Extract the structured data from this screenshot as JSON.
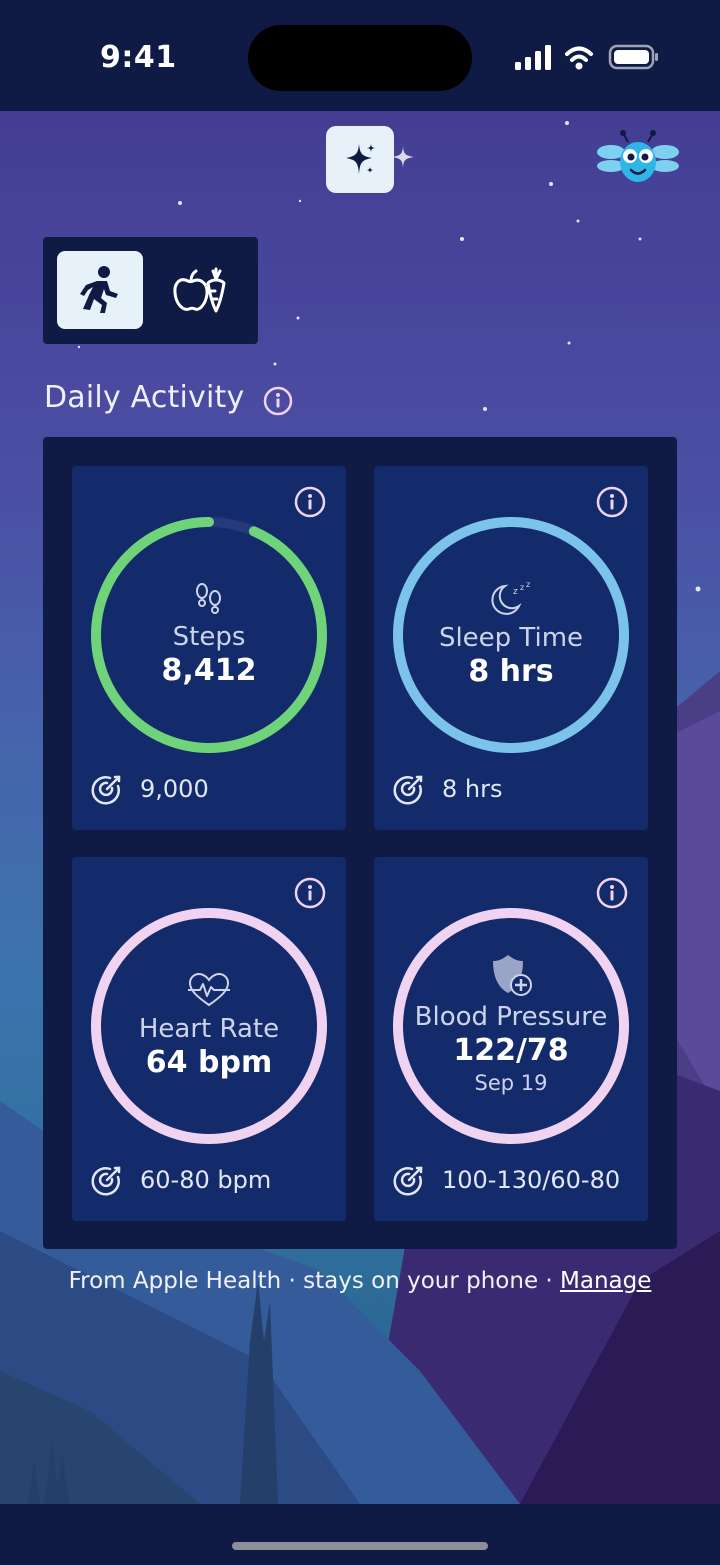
{
  "status_bar": {
    "time": "9:41"
  },
  "header": {
    "sparkle_icon": "sparkle-icon",
    "mascot": "dragonfly-mascot"
  },
  "tabs": [
    {
      "name": "activity",
      "icon": "running-person-icon",
      "selected": true
    },
    {
      "name": "nutrition",
      "icon": "apple-carrot-icon",
      "selected": false
    }
  ],
  "section": {
    "title": "Daily Activity"
  },
  "cards": {
    "steps": {
      "label": "Steps",
      "value": "8,412",
      "goal": "9,000",
      "progress": 0.935,
      "color": "#6fd37a"
    },
    "sleep": {
      "label": "Sleep Time",
      "value": "8 hrs",
      "goal": "8 hrs",
      "progress": 1.0,
      "color": "#7cc3ec"
    },
    "heart": {
      "label": "Heart Rate",
      "value": "64 bpm",
      "goal": "60-80 bpm",
      "progress": 1.0,
      "color": "#f0d3f1"
    },
    "bp": {
      "label": "Blood Pressure",
      "value": "122/78",
      "date": "Sep 19",
      "goal": "100-130/60-80",
      "progress": 1.0,
      "color": "#f0d3f1"
    }
  },
  "footer": {
    "note": "From Apple Health · stays on your phone · ",
    "manage_label": "Manage"
  }
}
